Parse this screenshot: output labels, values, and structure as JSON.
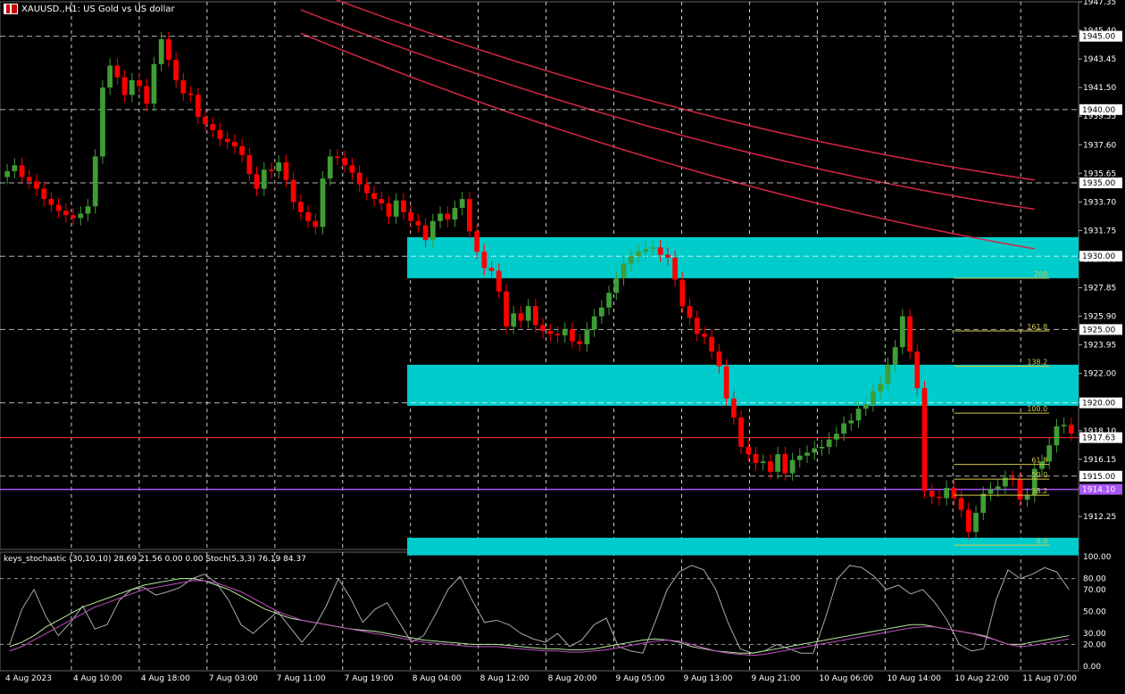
{
  "header": {
    "title": "XAUUSD.,H1:  US Gold vs US dollar",
    "subwindow": "keys_stochastic (30,10,10) 28.69 21.56 0.00 0.00 Stoch(5,3,3) 76.19 84.37"
  },
  "colors": {
    "background": "#000000",
    "bull": "#3f9d35",
    "bear": "#ff0000",
    "zone": "#00cccc",
    "box": "#00008b",
    "green_box": "#22c55e",
    "channel": "#a855f7",
    "ma": "#d62643",
    "fib": "#d4c84a",
    "arrow_up": "#00d4ff",
    "arrow_down": "#ff00ff"
  },
  "chart_data": [
    {
      "type": "candlestick",
      "symbol": "XAUUSD.",
      "timeframe": "H1",
      "ylim": [
        1910.0,
        1947.35
      ],
      "price_ticks": [
        "1947.35",
        "1945.40",
        "1943.45",
        "1941.50",
        "1939.55",
        "1937.60",
        "1935.65",
        "1933.70",
        "1931.75",
        "1929.80",
        "1927.85",
        "1925.90",
        "1923.95",
        "1922.00",
        "1920.05",
        "1918.10",
        "1916.15",
        "1914.20",
        "1912.25"
      ],
      "level_labels": [
        {
          "label": "1945.00",
          "value": 1945.0,
          "style": "dash"
        },
        {
          "label": "1940.00",
          "value": 1940.0,
          "style": "dash"
        },
        {
          "label": "1935.00",
          "value": 1935.0,
          "style": "dash"
        },
        {
          "label": "1930.00",
          "value": 1930.0,
          "style": "dash"
        },
        {
          "label": "1925.00",
          "value": 1925.0,
          "style": "dash"
        },
        {
          "label": "1920.00",
          "value": 1920.0,
          "style": "dash"
        },
        {
          "label": "1917.63",
          "value": 1917.63,
          "style": "bid"
        },
        {
          "label": "1915.00",
          "value": 1915.0,
          "style": "dash"
        },
        {
          "label": "1914.10",
          "value": 1914.1,
          "style": "purple"
        }
      ],
      "time_labels": [
        "4 Aug 2023",
        "4 Aug 10:00",
        "4 Aug 18:00",
        "7 Aug 03:00",
        "7 Aug 11:00",
        "7 Aug 19:00",
        "8 Aug 04:00",
        "8 Aug 12:00",
        "8 Aug 20:00",
        "9 Aug 05:00",
        "9 Aug 13:00",
        "9 Aug 21:00",
        "10 Aug 06:00",
        "10 Aug 14:00",
        "10 Aug 22:00",
        "11 Aug 07:00"
      ],
      "close": [
        1935.8,
        1936.2,
        1935.4,
        1935.1,
        1934.6,
        1933.9,
        1933.5,
        1933.1,
        1932.8,
        1932.6,
        1932.9,
        1933.4,
        1936.8,
        1941.5,
        1943.0,
        1942.2,
        1941.0,
        1942.0,
        1941.6,
        1940.4,
        1943.1,
        1944.8,
        1943.4,
        1942.0,
        1941.1,
        1941.0,
        1939.5,
        1939.0,
        1938.6,
        1938.0,
        1937.8,
        1937.5,
        1936.9,
        1935.6,
        1934.6,
        1935.9,
        1935.8,
        1936.4,
        1935.2,
        1933.7,
        1933.0,
        1932.4,
        1932.0,
        1935.3,
        1936.8,
        1936.7,
        1936.2,
        1935.7,
        1934.9,
        1934.3,
        1933.9,
        1933.6,
        1932.7,
        1933.8,
        1933.0,
        1932.4,
        1932.1,
        1931.1,
        1932.4,
        1932.9,
        1932.5,
        1933.3,
        1933.9,
        1931.7,
        1930.3,
        1929.2,
        1929.0,
        1927.6,
        1925.2,
        1926.1,
        1925.6,
        1926.6,
        1925.3,
        1924.9,
        1924.7,
        1924.6,
        1925.0,
        1924.2,
        1924.0,
        1925.0,
        1925.9,
        1926.5,
        1927.5,
        1928.5,
        1929.5,
        1930.0,
        1930.3,
        1930.5,
        1930.6,
        1930.1,
        1929.9,
        1928.4,
        1926.6,
        1925.8,
        1924.7,
        1924.5,
        1923.5,
        1922.5,
        1920.3,
        1919.0,
        1917.0,
        1916.5,
        1915.9,
        1916.0,
        1915.3,
        1916.5,
        1915.2,
        1916.1,
        1916.4,
        1916.6,
        1916.9,
        1917.0,
        1917.5,
        1917.9,
        1918.6,
        1918.8,
        1919.6,
        1919.9,
        1920.8,
        1921.3,
        1922.6,
        1923.8,
        1925.9,
        1923.5,
        1921.0,
        1914.0,
        1913.6,
        1913.5,
        1914.2,
        1913.5,
        1912.7,
        1911.2,
        1912.5,
        1913.8,
        1914.1,
        1914.3,
        1914.9,
        1914.8,
        1913.4,
        1913.7,
        1915.5,
        1916.0,
        1917.1,
        1918.4,
        1918.5,
        1917.9
      ],
      "zones": [
        {
          "from": 1928.5,
          "to": 1931.3,
          "start": 55
        },
        {
          "from": 1919.8,
          "to": 1922.6,
          "start": 55
        },
        {
          "from": 1909.6,
          "to": 1910.8,
          "start": 55
        }
      ],
      "fibonacci": [
        {
          "label": "200",
          "value": 1928.5
        },
        {
          "label": "161.8",
          "value": 1924.9
        },
        {
          "label": "138.2",
          "value": 1922.5
        },
        {
          "label": "100.0",
          "value": 1919.3
        },
        {
          "label": "61.8",
          "value": 1915.8
        },
        {
          "label": "50.0",
          "value": 1914.8
        },
        {
          "label": "38.2",
          "value": 1913.7
        },
        {
          "label": "0.0",
          "value": 1910.3
        }
      ]
    },
    {
      "type": "line",
      "ylim": [
        0,
        100
      ],
      "y_ticks": [
        "100.00",
        "80.00",
        "70.00",
        "50.00",
        "30.00",
        "20.00",
        "0.00"
      ],
      "levels": [
        80,
        20
      ],
      "series": [
        {
          "color": "#aaaaaa",
          "values": [
            20,
            52,
            70,
            45,
            28,
            40,
            55,
            34,
            38,
            60,
            70,
            72,
            65,
            68,
            72,
            80,
            84,
            76,
            60,
            38,
            30,
            40,
            50,
            36,
            22,
            35,
            55,
            80,
            62,
            40,
            52,
            58,
            40,
            22,
            28,
            48,
            70,
            82,
            60,
            40,
            42,
            38,
            30,
            25,
            22,
            30,
            18,
            24,
            38,
            44,
            18,
            14,
            12,
            40,
            70,
            86,
            92,
            88,
            70,
            40,
            16,
            12,
            14,
            20,
            16,
            12,
            12,
            44,
            80,
            92,
            90,
            82,
            70,
            74,
            66,
            70,
            58,
            42,
            20,
            14,
            16,
            60,
            88,
            80,
            84,
            90,
            86,
            70
          ]
        },
        {
          "color": "#b8e8a0",
          "values": [
            18,
            22,
            28,
            36,
            42,
            48,
            54,
            58,
            62,
            66,
            70,
            74,
            76,
            78,
            80,
            80,
            78,
            74,
            70,
            64,
            58,
            52,
            48,
            44,
            42,
            40,
            38,
            36,
            34,
            33,
            32,
            30,
            28,
            26,
            24,
            23,
            22,
            21,
            20,
            20,
            20,
            19,
            18,
            17,
            16,
            16,
            15,
            15,
            16,
            18,
            20,
            22,
            24,
            25,
            24,
            22,
            18,
            16,
            14,
            13,
            12,
            12,
            14,
            16,
            18,
            20,
            22,
            24,
            26,
            28,
            30,
            32,
            34,
            36,
            38,
            38,
            36,
            34,
            32,
            30,
            28,
            24,
            20,
            20,
            22,
            24,
            26,
            28
          ]
        },
        {
          "color": "#c050c0",
          "values": [
            14,
            18,
            24,
            30,
            36,
            42,
            48,
            54,
            58,
            62,
            66,
            70,
            72,
            74,
            76,
            78,
            78,
            76,
            72,
            68,
            62,
            56,
            50,
            46,
            42,
            40,
            38,
            36,
            34,
            32,
            30,
            28,
            26,
            24,
            22,
            21,
            20,
            19,
            18,
            18,
            18,
            17,
            16,
            15,
            14,
            14,
            13,
            13,
            14,
            15,
            17,
            19,
            21,
            23,
            24,
            23,
            20,
            17,
            14,
            12,
            11,
            10,
            11,
            13,
            15,
            17,
            19,
            21,
            23,
            25,
            27,
            29,
            31,
            33,
            35,
            36,
            36,
            34,
            32,
            30,
            27,
            24,
            20,
            18,
            19,
            21,
            23,
            25
          ]
        }
      ]
    }
  ]
}
